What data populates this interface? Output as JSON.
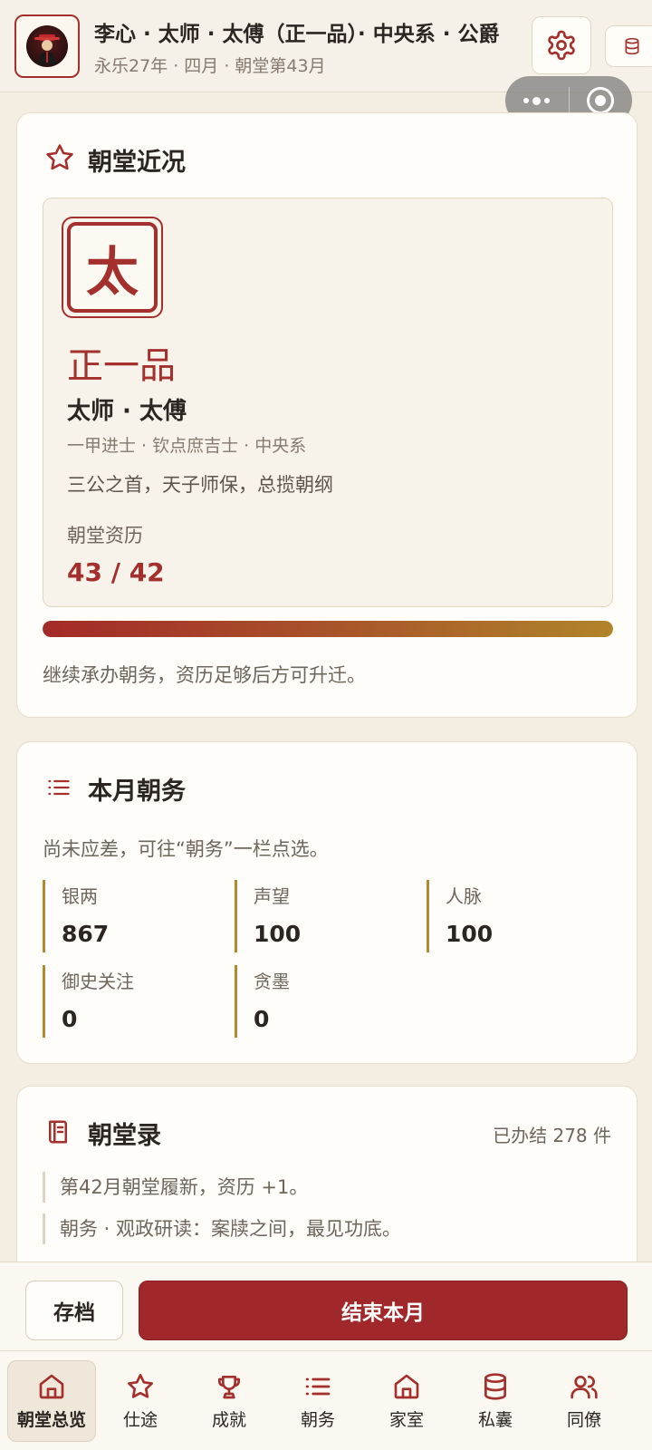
{
  "header": {
    "title": "李心 · 太师 · 太傅（正一品）· 中央系 · 公爵",
    "subtitle": "永乐27年 · 四月 · 朝堂第43月"
  },
  "court_status": {
    "title": "朝堂近况",
    "seal_char": "太",
    "grade": "正一品",
    "office": "太师 · 太傅",
    "meta": "一甲进士 · 钦点庶吉士 · 中央系",
    "description": "三公之首，天子师保，总揽朝纲",
    "qualification_label": "朝堂资历",
    "qualification_value": "43 / 42",
    "progress_fraction": 1.0,
    "note": "继续承办朝务，资历足够后方可升迁。"
  },
  "monthly_affairs": {
    "title": "本月朝务",
    "note": "尚未应差，可往“朝务”一栏点选。",
    "stats": [
      {
        "label": "银两",
        "value": "867"
      },
      {
        "label": "声望",
        "value": "100"
      },
      {
        "label": "人脉",
        "value": "100"
      },
      {
        "label": "御史关注",
        "value": "0"
      },
      {
        "label": "贪墨",
        "value": "0"
      }
    ]
  },
  "court_record": {
    "title": "朝堂录",
    "count": "已办结 278 件",
    "entries": [
      "第42月朝堂履新，资历 +1。",
      "朝务 · 观政研读：案牍之间，最见功底。"
    ]
  },
  "actions": {
    "save": "存档",
    "end_month": "结束本月"
  },
  "nav": [
    {
      "label": "朝堂总览",
      "icon": "home-icon"
    },
    {
      "label": "仕途",
      "icon": "star-icon"
    },
    {
      "label": "成就",
      "icon": "trophy-icon"
    },
    {
      "label": "朝务",
      "icon": "list-icon"
    },
    {
      "label": "家室",
      "icon": "home-icon"
    },
    {
      "label": "私囊",
      "icon": "coins-icon"
    },
    {
      "label": "同僚",
      "icon": "users-icon"
    }
  ],
  "colors": {
    "accent": "#a0282a",
    "gold": "#b08a2e",
    "background": "#f3ede2"
  }
}
